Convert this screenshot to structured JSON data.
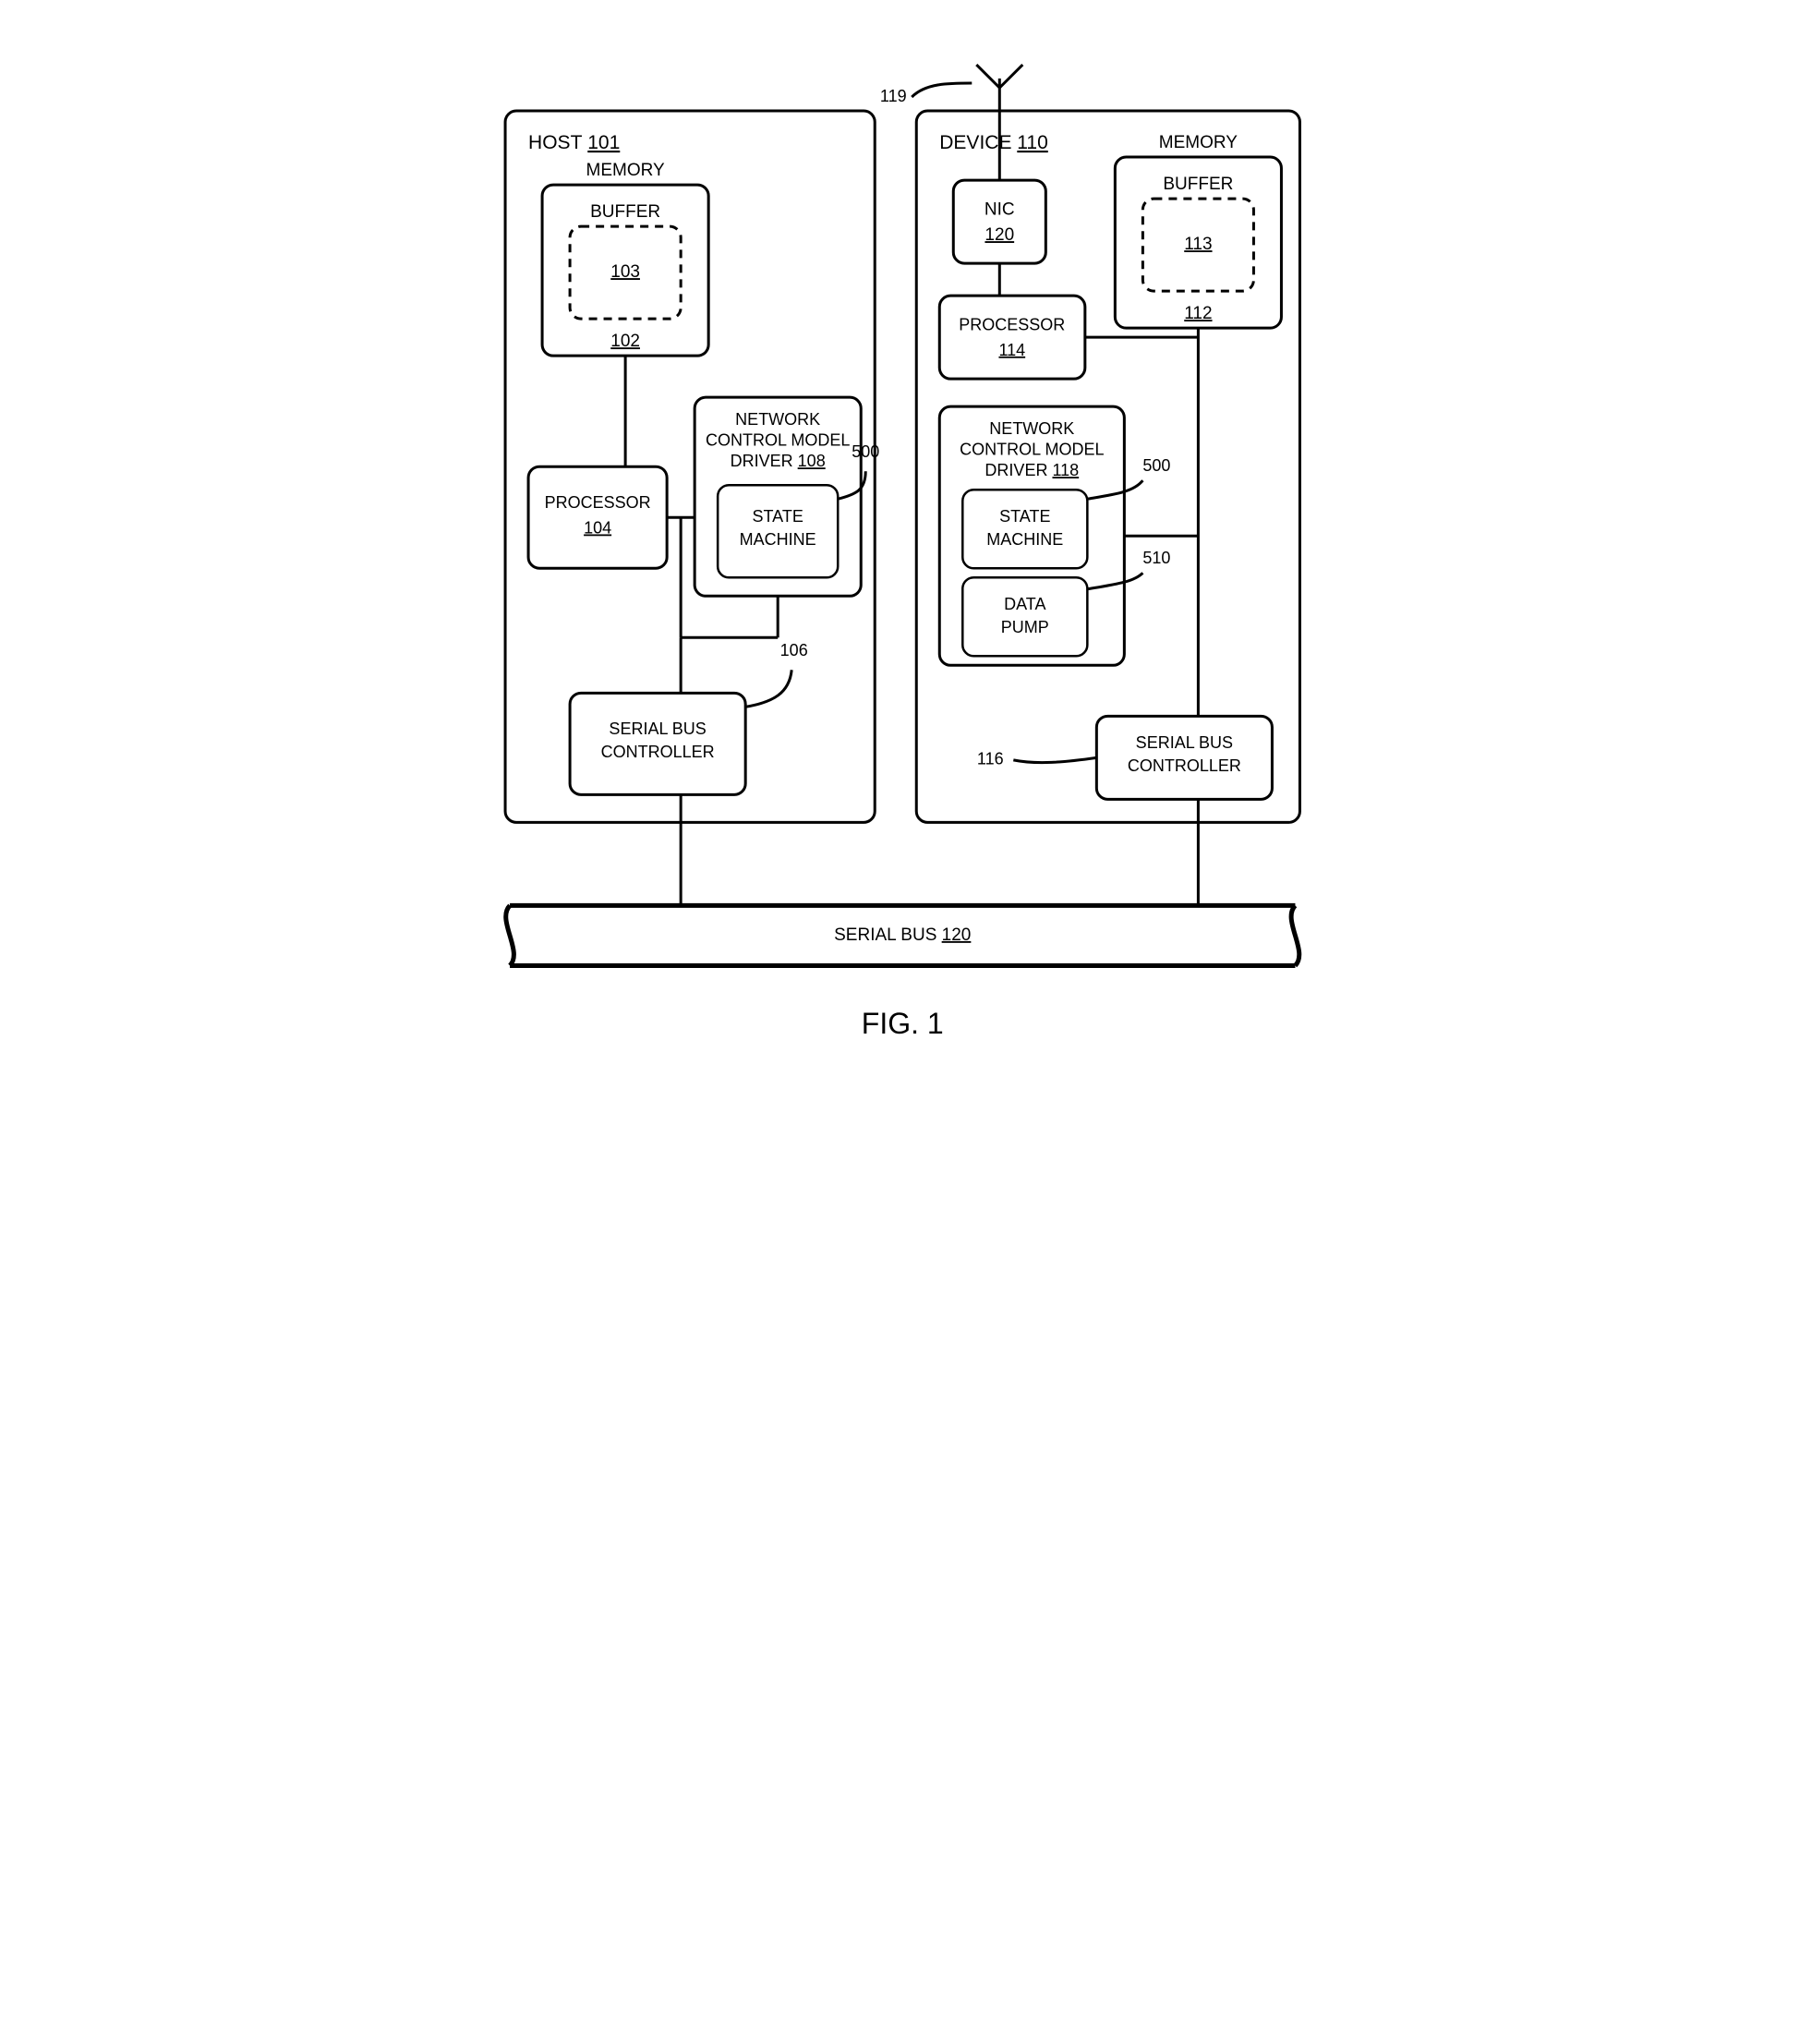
{
  "figure_label": "FIG. 1",
  "host": {
    "title_prefix": "HOST",
    "title_ref": "101",
    "memory_label": "MEMORY",
    "memory_ref": "102",
    "buffer_label": "BUFFER",
    "buffer_ref": "103",
    "processor_label": "PROCESSOR",
    "processor_ref": "104",
    "driver_line1": "NETWORK",
    "driver_line2": "CONTROL MODEL",
    "driver_line3_prefix": "DRIVER",
    "driver_ref": "108",
    "state_line1": "STATE",
    "state_line2": "MACHINE",
    "state_callout": "500",
    "sbc_line1": "SERIAL BUS",
    "sbc_line2": "CONTROLLER",
    "sbc_callout": "106"
  },
  "device": {
    "title_prefix": "DEVICE",
    "title_ref": "110",
    "nic_label": "NIC",
    "nic_ref": "120",
    "memory_label": "MEMORY",
    "memory_ref": "112",
    "buffer_label": "BUFFER",
    "buffer_ref": "113",
    "processor_label": "PROCESSOR",
    "processor_ref": "114",
    "driver_line1": "NETWORK",
    "driver_line2": "CONTROL MODEL",
    "driver_line3_prefix": "DRIVER",
    "driver_ref": "118",
    "state_line1": "STATE",
    "state_line2": "MACHINE",
    "state_callout": "500",
    "pump_line1": "DATA",
    "pump_line2": "PUMP",
    "pump_callout": "510",
    "sbc_line1": "SERIAL BUS",
    "sbc_line2": "CONTROLLER",
    "sbc_callout": "116"
  },
  "bus": {
    "label_prefix": "SERIAL BUS",
    "label_ref": "120"
  },
  "antenna_callout": "119"
}
